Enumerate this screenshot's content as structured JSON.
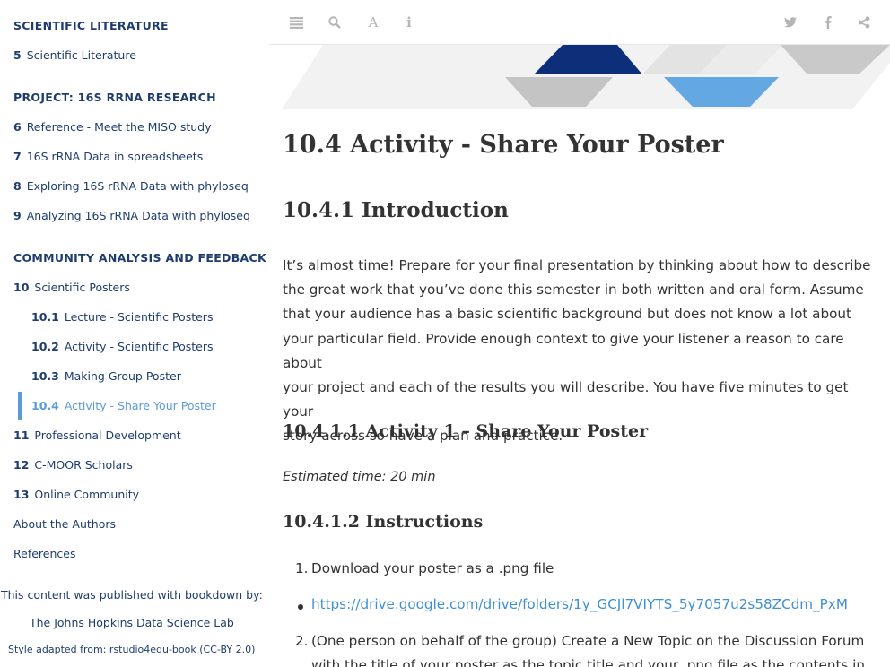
{
  "sidebar": {
    "section_lit": "SCIENTIFIC LITERATURE",
    "item_5": {
      "num": "5",
      "label": "Scientific Literature"
    },
    "section_project": "PROJECT: 16S RRNA RESEARCH",
    "item_6": {
      "num": "6",
      "label": "Reference - Meet the MISO study"
    },
    "item_7": {
      "num": "7",
      "label": "16S rRNA Data in spreadsheets"
    },
    "item_8": {
      "num": "8",
      "label": "Exploring 16S rRNA Data with phyloseq"
    },
    "item_9": {
      "num": "9",
      "label": "Analyzing 16S rRNA Data with phyloseq"
    },
    "section_community": "COMMUNITY ANALYSIS AND FEEDBACK",
    "item_10": {
      "num": "10",
      "label": "Scientific Posters"
    },
    "item_10_1": {
      "num": "10.1",
      "label": "Lecture - Scientific Posters"
    },
    "item_10_2": {
      "num": "10.2",
      "label": "Activity - Scientific Posters"
    },
    "item_10_3": {
      "num": "10.3",
      "label": "Making Group Poster"
    },
    "item_10_4": {
      "num": "10.4",
      "label": "Activity - Share Your Poster"
    },
    "item_11": {
      "num": "11",
      "label": "Professional Development"
    },
    "item_12": {
      "num": "12",
      "label": "C-MOOR Scholars"
    },
    "item_13": {
      "num": "13",
      "label": "Online Community"
    },
    "about": "About the Authors",
    "references": "References",
    "published": "This content was published with bookdown by:",
    "jhu": "The Johns Hopkins Data Science Lab",
    "style": "Style adapted from: rstudio4edu-book (CC-BY 2.0)"
  },
  "toolbar": {
    "toc_icon": "list-icon",
    "search_icon": "search-icon",
    "font_icon": "font-icon",
    "info_icon": "info-icon",
    "twitter_icon": "twitter-icon",
    "facebook_icon": "facebook-icon",
    "share_icon": "share-icon",
    "icon_color": "#b5b5b5"
  },
  "colors": {
    "sidebar_text": "#1e3d6e",
    "active": "#5a9bd8",
    "link": "#3d8fd6"
  },
  "content": {
    "h1": "10.4   Activity - Share Your Poster",
    "h2": "10.4.1   Introduction",
    "para_lines": [
      "It’s almost time! Prepare for your final presentation by thinking about how to describe",
      "the great work that you’ve done this semester in both written and oral form. Assume",
      "that your audience has a basic scientific background but does not know a lot about",
      "your particular field. Provide enough context to give your listener a reason to care about",
      "your project and each of the results you will describe. You have five minutes to get your",
      "story across so have a plan and practice."
    ],
    "h4_1": "10.4.1.1   Activity 1 – Share Your Poster",
    "estimated": "Estimated time: 20 min",
    "h4_2": "10.4.1.2   Instructions",
    "step1_num": "1.",
    "step1": "Download your poster as a .png file",
    "link": "https://drive.google.com/drive/folders/1y_GCJl7VIYTS_5y7057u2s58ZCdm_PxM",
    "step2_num": "2.",
    "step2_line1": "(One person on behalf of the group) Create a New Topic on the Discussion Forum",
    "step2_line2": "with the title of your poster as the topic title and your .png file as the contents in"
  }
}
